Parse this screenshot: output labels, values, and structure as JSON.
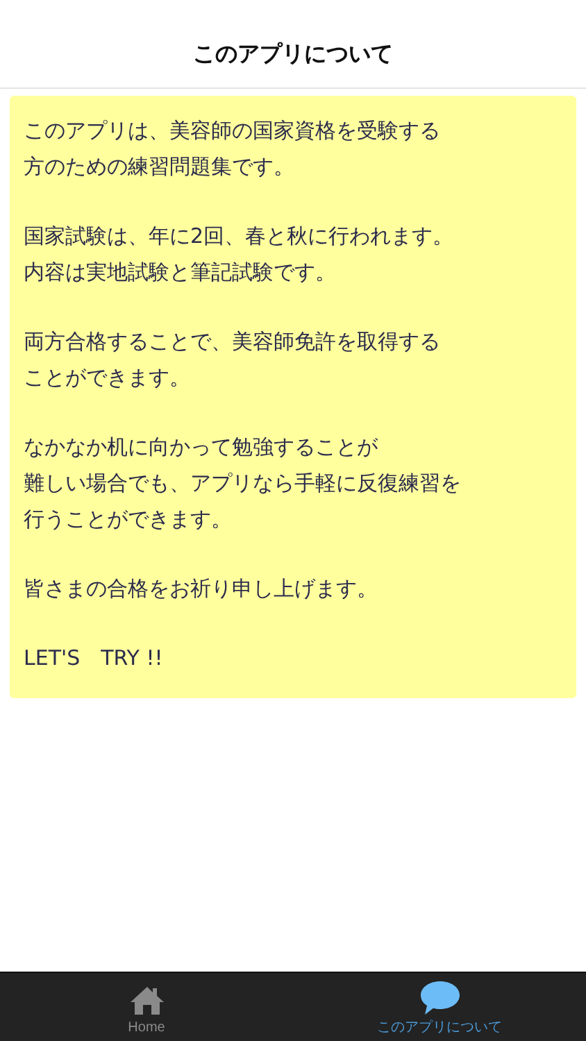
{
  "header": {
    "title": "このアプリについて"
  },
  "paragraphs": [
    [
      "このアプリは、美容師の国家資格を受験する",
      "方のための練習問題集です。"
    ],
    [
      "国家試験は、年に2回、春と秋に行われます。",
      "内容は実地試験と筆記試験です。"
    ],
    [
      "両方合格することで、美容師免許を取得する",
      "ことができます。"
    ],
    [
      "なかなか机に向かって勉強することが",
      "難しい場合でも、アプリなら手軽に反復練習を",
      "行うことができます。"
    ],
    [
      "皆さまの合格をお祈り申し上げます。"
    ],
    [
      "LET'S　TRY !!"
    ]
  ],
  "tabs": [
    {
      "kind": "home",
      "label": "Home",
      "selected": false
    },
    {
      "kind": "about",
      "label": "このアプリについて",
      "selected": true
    }
  ]
}
